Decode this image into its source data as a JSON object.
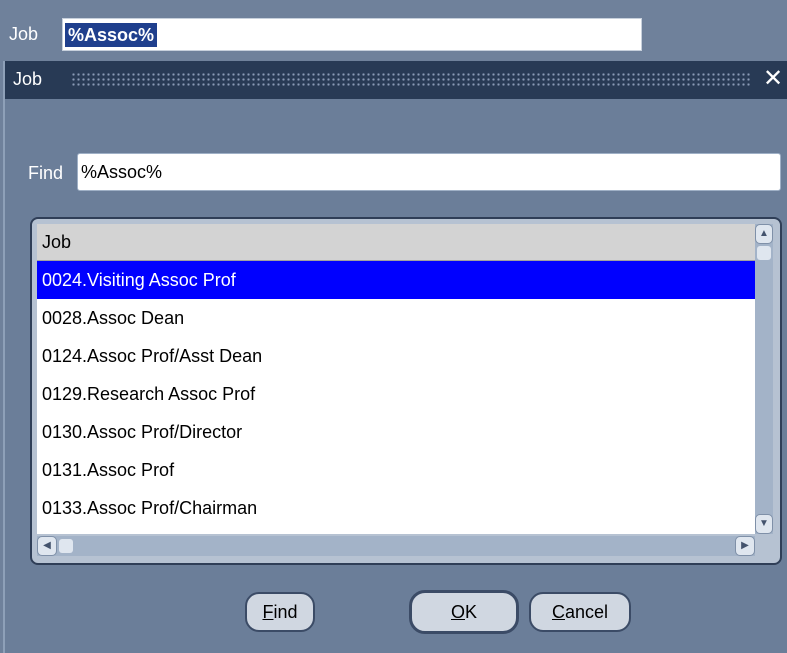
{
  "background": {
    "label": "Job",
    "value": "%Assoc%"
  },
  "dialog": {
    "title": "Job",
    "close_icon": "✕",
    "find_label": "Find",
    "find_value": "%Assoc%",
    "list": {
      "column_header": "Job",
      "rows": [
        "0024.Visiting Assoc Prof",
        "0028.Assoc Dean",
        "0124.Assoc Prof/Asst Dean",
        "0129.Research Assoc Prof",
        "0130.Assoc Prof/Director",
        "0131.Assoc Prof",
        "0133.Assoc Prof/Chairman"
      ],
      "selected_index": 0
    },
    "buttons": {
      "find": {
        "mnemonic": "F",
        "rest": "ind"
      },
      "ok": {
        "mnemonic": "O",
        "rest": "K"
      },
      "cancel": {
        "mnemonic": "C",
        "rest": "ancel"
      }
    }
  },
  "colors": {
    "selection": "#0000ff",
    "titlebar": "#283a55",
    "background": "#6f819b"
  }
}
